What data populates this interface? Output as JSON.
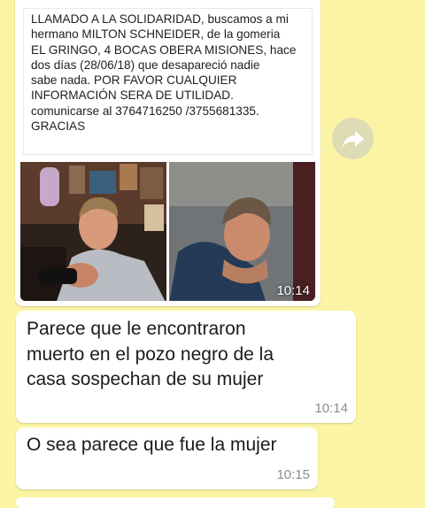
{
  "messages": [
    {
      "caption_lines": [
        "LLAMADO A LA SOLIDARIDAD, buscamos a mi",
        "hermano MILTON SCHNEIDER, de la gomeria",
        "EL GRINGO, 4 BOCAS OBERA MISIONES, hace",
        "dos días  (28/06/18) que desapareció nadie",
        "sabe nada. POR FAVOR CUALQUIER",
        "INFORMACIÓN SERA DE UTILIDAD.",
        "comunicarse al 3764716250 /3755681335.",
        "GRACIAS"
      ],
      "time": "10:14"
    },
    {
      "lines": [
        "Parece que le encontraron",
        "muerto en el pozo negro de la",
        "casa sospechan de su mujer"
      ],
      "time": "10:14"
    },
    {
      "text": "O sea parece que fue la mujer",
      "time": "10:15"
    }
  ],
  "share_icon": "forward-arrow-icon",
  "colors": {
    "background": "#fbf4a4",
    "bubble": "#ffffff",
    "timestamp": "#8c8c8c"
  }
}
